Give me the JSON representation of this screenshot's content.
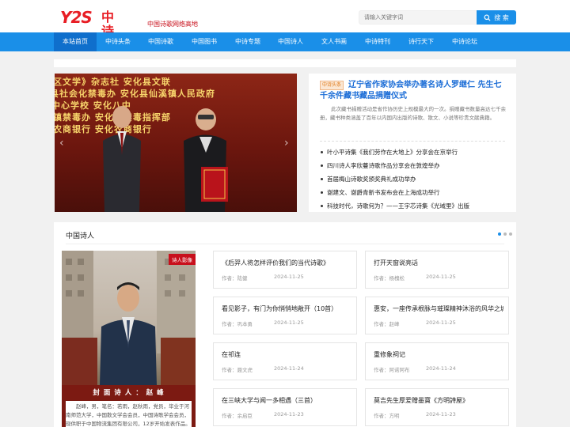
{
  "header": {
    "logo_mark": "Y2S",
    "logo_text": "中诗网",
    "slogan": "中国诗歌网络高地",
    "search_placeholder": "请输入关键字词",
    "search_button": "搜 索"
  },
  "nav": {
    "items": [
      "本站首页",
      "中诗头条",
      "中国诗歌",
      "中国图书",
      "中诗专题",
      "中国诗人",
      "文人书画",
      "中诗特刊",
      "诗行天下",
      "中诗论坛"
    ],
    "active_index": 0
  },
  "slider": {
    "banner_lines": [
      "区文学》杂志社  安化县文联",
      "县社会化禁毒办  安化县仙溪镇人民政府",
      "中心学校  安化八中",
      "镇禁毒办  安化县禁毒指挥部",
      "农商银行  安化农商银行"
    ]
  },
  "headline": {
    "tag": "中诗头条",
    "title": "辽宁省作家协会举办著名诗人罗继仁 先生七千余件藏书藏品捐赠仪式",
    "summary": "此次藏书捐赠活动是省作协历史上规模最大的一次。捐赠藏书数量高达七千余册，藏书种类涵盖了百年以内国内出版的诗歌、散文、小说等珍贵文献典籍。",
    "items": [
      "叶小平诗集《我们劳作在大地上》分享会在京举行",
      "四川诗人李欣蔓诗歌作品分享会在敦煌举办",
      "首届梅山诗歌奖颁奖典礼成功举办",
      "谢建文、谢爵青新书发布会在上海成功举行",
      "科技时代，诗歌何为？——王宇芯诗集《光域里》出版"
    ]
  },
  "section": {
    "title": "中国诗人",
    "poet_tag": "诗人影像",
    "poet_caption": "封 面 诗 人 ： 赵 峰",
    "poet_desc": "赵峰，男，笔名：若雨，赵秋雨，党员，毕业于河南师范大学，中国散文学会会员，中国诗歌学会会员，现供职于中国物流集团有限公司，12岁开始发表作品。",
    "articles": [
      {
        "title": "《后羿人将怎样评价我们的当代诗歌》",
        "author": "作者：陆健",
        "date": "2024-11-25"
      },
      {
        "title": "打开天窗说亮话",
        "author": "作者：杨槐松",
        "date": "2024-11-25"
      },
      {
        "title": "看见影子，有门为你悄悄地敞开（10首）",
        "author": "作者：巩本勇",
        "date": "2024-11-25"
      },
      {
        "title": "惠安，一座传承根脉与璀璨精神沐浴的风华之城",
        "author": "作者：赵峰",
        "date": "2024-11-25"
      },
      {
        "title": "在祁连",
        "author": "作者：聂文虎",
        "date": "2024-11-24"
      },
      {
        "title": "重修象祠记",
        "author": "作者：阿诺阿布",
        "date": "2024-11-24"
      },
      {
        "title": "在三峡大学与闻一多相遇（三首）",
        "author": "作者：余启臣",
        "date": "2024-11-23"
      },
      {
        "title": "莫吉先生厚爱赠墨寶《方明詩屋》",
        "author": "作者：方明",
        "date": "2024-11-23"
      }
    ]
  },
  "colors": {
    "brand_red": "#e81e25",
    "nav_blue": "#1a8fe8",
    "nav_active": "#0f6fcc",
    "headline_blue": "#1a6cd6"
  }
}
